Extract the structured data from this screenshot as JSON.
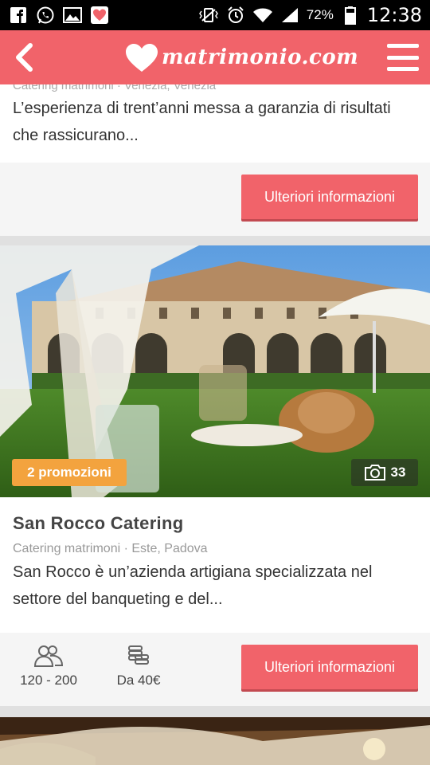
{
  "status_bar": {
    "battery": "72%",
    "time": "12:38",
    "left_icons": [
      "facebook-icon",
      "whatsapp-icon",
      "gallery-icon",
      "heart-app-icon"
    ],
    "right_icons": [
      "vibrate-icon",
      "alarm-icon",
      "wifi-icon",
      "signal-icon",
      "battery-icon"
    ]
  },
  "header": {
    "logo_text": "matrimonio.com",
    "brand_color": "#f1636a"
  },
  "listings": [
    {
      "meta": "Catering matrimoni · Venezia, Venezia",
      "description": "L’esperienza di trent’anni messa a garanzia di risultati che rassicurano...",
      "cta": "Ulteriori informazioni"
    },
    {
      "promo": "2 promozioni",
      "photo_count": "33",
      "title": "San Rocco Catering",
      "meta": "Catering matrimoni · Este, Padova",
      "description": "San Rocco è un’azienda artigiana specializzata nel settore del banqueting e del...",
      "guests": "120 - 200",
      "price": "Da 40€",
      "cta": "Ulteriori informazioni"
    }
  ],
  "colors": {
    "accent": "#f1636a",
    "promo": "#f3a33e"
  }
}
